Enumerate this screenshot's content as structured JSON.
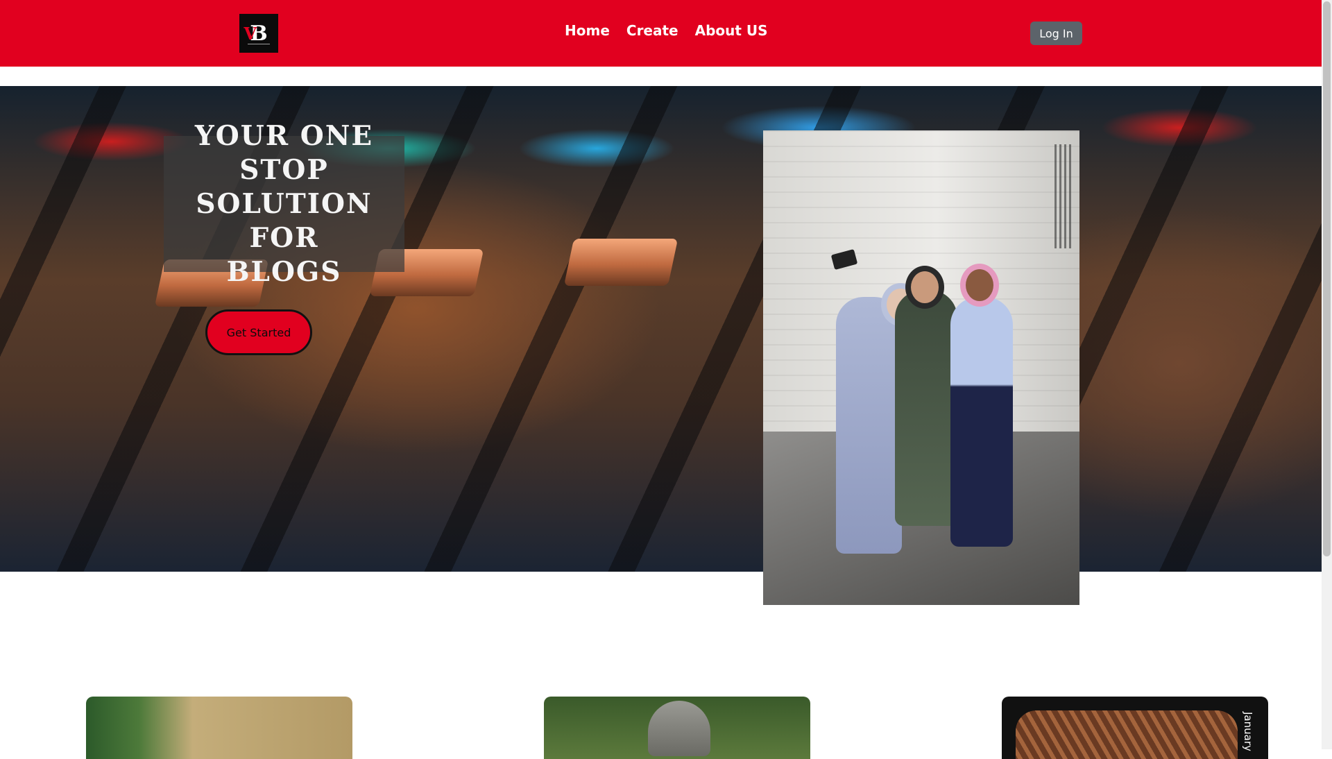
{
  "nav": {
    "logo_text": "B",
    "logo_accent": "V",
    "links": [
      "Home",
      "Create",
      "About US"
    ],
    "login_label": "Log In"
  },
  "hero": {
    "title_lines": [
      "YOUR ONE",
      "STOP",
      "SOLUTION FOR",
      "BLOGS"
    ],
    "cta_label": "Get Started"
  },
  "cards": {
    "third_date": "January"
  },
  "colors": {
    "brand_red": "#e1001f",
    "login_gray": "#5c636a",
    "logo_black": "#0b0b0b"
  }
}
